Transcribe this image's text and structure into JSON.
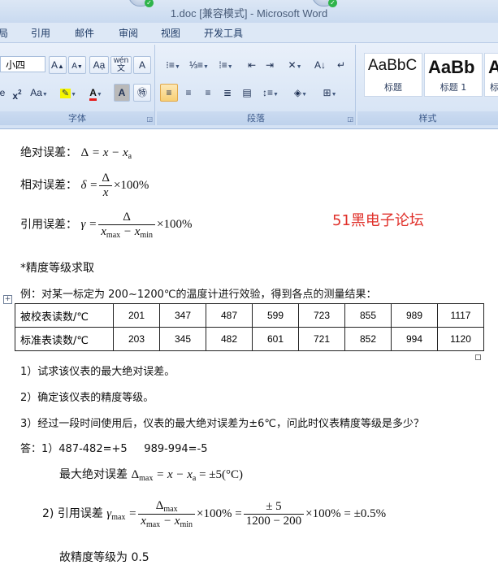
{
  "window": {
    "title": "1.doc [兼容模式] - Microsoft Word"
  },
  "menu": [
    "局",
    "引用",
    "邮件",
    "审阅",
    "视图",
    "开发工具"
  ],
  "ribbon": {
    "font_size_value": "小四",
    "groups": {
      "font": "字体",
      "paragraph": "段落",
      "styles": "样式"
    },
    "styles": [
      {
        "sample": "AaBbC",
        "name": "标题"
      },
      {
        "sample": "AaBb",
        "name": "标题 1"
      },
      {
        "sample": "A",
        "name": "标"
      }
    ]
  },
  "doc": {
    "abs_error_label": "绝对误差：",
    "rel_error_label": "相对误差：",
    "ref_error_label": "引用误差：",
    "watermark": "51黑电子论坛",
    "precision_heading": "*精度等级求取",
    "example": "例：对某一标定为 200~1200℃的温度计进行效验，得到各点的测量结果：",
    "table": {
      "rows": [
        {
          "label": "被校表读数/℃",
          "values": [
            "201",
            "347",
            "487",
            "599",
            "723",
            "855",
            "989",
            "1117"
          ]
        },
        {
          "label": "标准表读数/℃",
          "values": [
            "203",
            "345",
            "482",
            "601",
            "721",
            "852",
            "994",
            "1120"
          ]
        }
      ]
    },
    "questions": [
      "1）试求该仪表的最大绝对误差。",
      "2）确定该仪表的精度等级。",
      "3）经过一段时间使用后，仪表的最大绝对误差为±6℃，问此时仪表精度等级是多少？"
    ],
    "answer_line": "答：1）487-482=+5     989-994=-5",
    "max_abs_label": "最大绝对误差",
    "ref_error_answer_label": "2) 引用误差",
    "conclusion": "故精度等级为 0.5"
  }
}
